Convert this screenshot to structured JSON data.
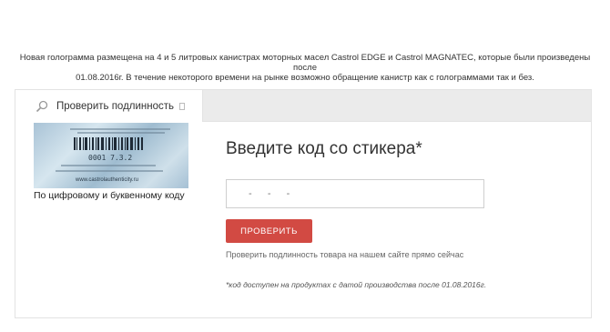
{
  "notice": {
    "line1": "Новая голограмма размещена на 4 и 5 литровых канистрах моторных масел Castrol EDGE и Castrol MAGNATEC, которые были произведены после",
    "line2": "01.08.2016г. В течение некоторого времени на рынке возможно обращение канистр как с голограммами так и без."
  },
  "tab": {
    "label": "Проверить подлинность",
    "icon": "search-icon"
  },
  "hologram": {
    "code_text": "0001 7.3.2",
    "site_text": "www.castrolauthenticity.ru",
    "caption": "По цифровому и буквенному коду"
  },
  "form": {
    "heading": "Введите код со стикера*",
    "input_placeholder": "-   -   -",
    "input_value": "",
    "button_label": "ПРОВЕРИТЬ",
    "subtext": "Проверить подлинность товара на нашем сайте прямо сейчас",
    "footnote": "*код доступен на продуктах с датой производства после 01.08.2016г."
  },
  "colors": {
    "accent": "#d24a43",
    "tabbar": "#ebebeb",
    "border": "#e3e3e3"
  }
}
